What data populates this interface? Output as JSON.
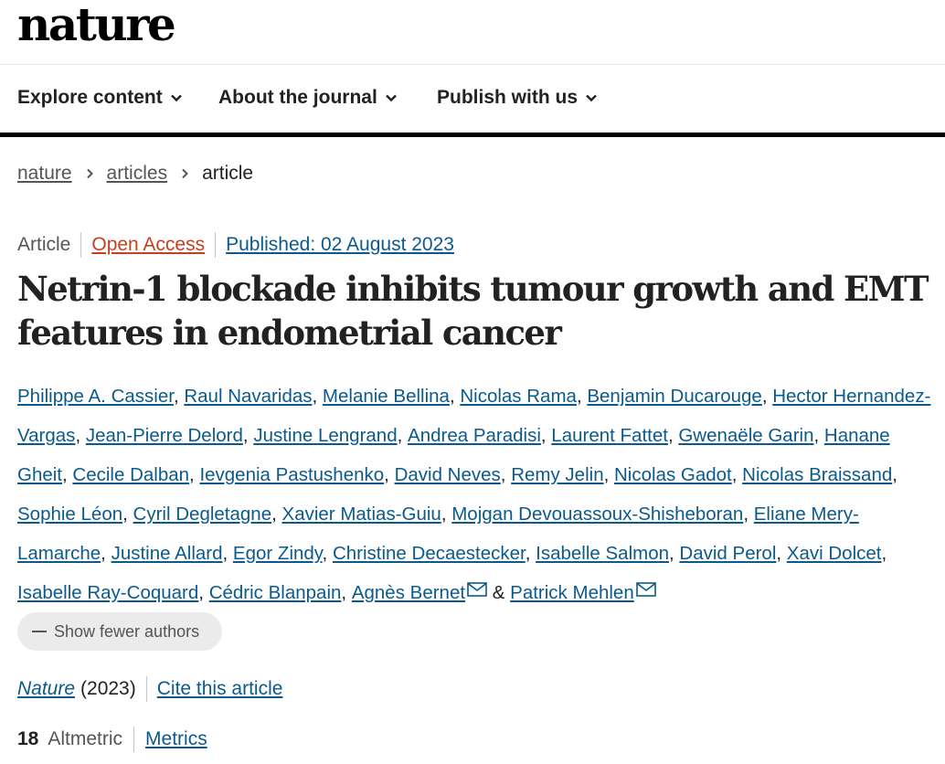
{
  "masthead": {
    "logo": "nature"
  },
  "nav": {
    "items": [
      {
        "label": "Explore content",
        "icon": "chevron-down-icon"
      },
      {
        "label": "About the journal",
        "icon": "chevron-down-icon"
      },
      {
        "label": "Publish with us",
        "icon": "chevron-down-icon"
      }
    ]
  },
  "breadcrumb": {
    "items": [
      "nature",
      "articles",
      "article"
    ],
    "separator_icon": "chevron-right-icon"
  },
  "article": {
    "type": "Article",
    "access": "Open Access",
    "published": "Published: 02 August 2023",
    "title": "Netrin-1 blockade inhibits tumour growth and EMT features in endometrial cancer",
    "authors": [
      "Philippe A. Cassier",
      "Raul Navaridas",
      "Melanie Bellina",
      "Nicolas Rama",
      "Benjamin Ducarouge",
      "Hector Hernandez-Vargas",
      "Jean-Pierre Delord",
      "Justine Lengrand",
      "Andrea Paradisi",
      "Laurent Fattet",
      "Gwenaële Garin",
      "Hanane Gheit",
      "Cecile Dalban",
      "Ievgenia Pastushenko",
      "David Neves",
      "Remy Jelin",
      "Nicolas Gadot",
      "Nicolas Braissand",
      "Sophie Léon",
      "Cyril Degletagne",
      "Xavier Matias-Guiu",
      "Mojgan Devouassoux-Shisheboran",
      "Eliane Mery-Lamarche",
      "Justine Allard",
      "Egor Zindy",
      "Christine Decaestecker",
      "Isabelle Salmon",
      "David Perol",
      "Xavi Dolcet",
      "Isabelle Ray-Coquard",
      "Cédric Blanpain",
      "Agnès Bernet",
      "Patrick Mehlen"
    ],
    "corresponding_icon": "envelope-icon",
    "ampersand": "&",
    "author_separator": ",",
    "show_fewer_label": "Show fewer authors",
    "journal": "Nature",
    "year": "(2023)",
    "cite_label": "Cite this article",
    "altmetric_score": "18",
    "altmetric_label": "Altmetric",
    "metrics_label": "Metrics"
  },
  "colors": {
    "link": "#0B5A8E",
    "open_access": "#c63f1f",
    "text": "#222222",
    "muted": "#555555",
    "pill_bg": "#ebebeb"
  }
}
